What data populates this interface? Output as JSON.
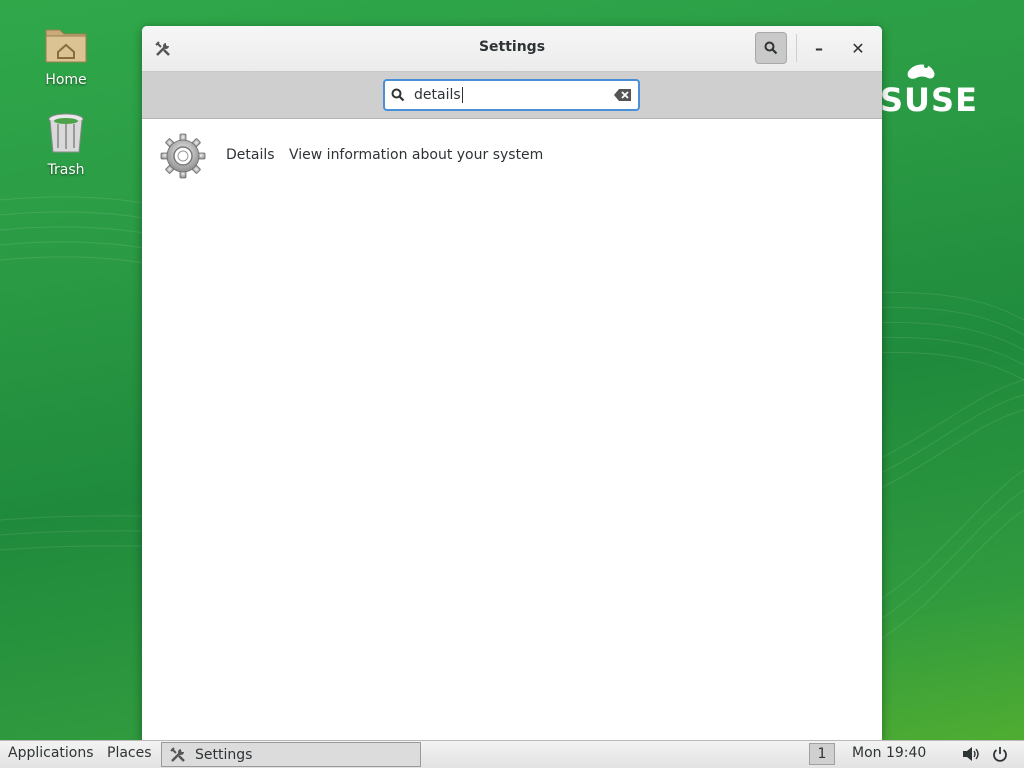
{
  "desktop": {
    "icons": [
      {
        "label": "Home",
        "icon": "home-folder-icon"
      },
      {
        "label": "Trash",
        "icon": "trash-icon"
      }
    ],
    "brand": "SUSE"
  },
  "window": {
    "title": "Settings",
    "app_icon": "settings-tools-icon",
    "search_toggle_icon": "search-icon",
    "minimize_label": "–",
    "close_label": "✕",
    "search": {
      "value": "details"
    },
    "results": [
      {
        "name": "Details",
        "description": "View information about your system",
        "icon": "gear-icon"
      }
    ]
  },
  "taskbar": {
    "applications": "Applications",
    "places": "Places",
    "task_label": "Settings",
    "workspace": "1",
    "clock": "Mon 19:40"
  },
  "colors": {
    "accent": "#4a90d9",
    "desktop_green": "#2a9a44"
  }
}
